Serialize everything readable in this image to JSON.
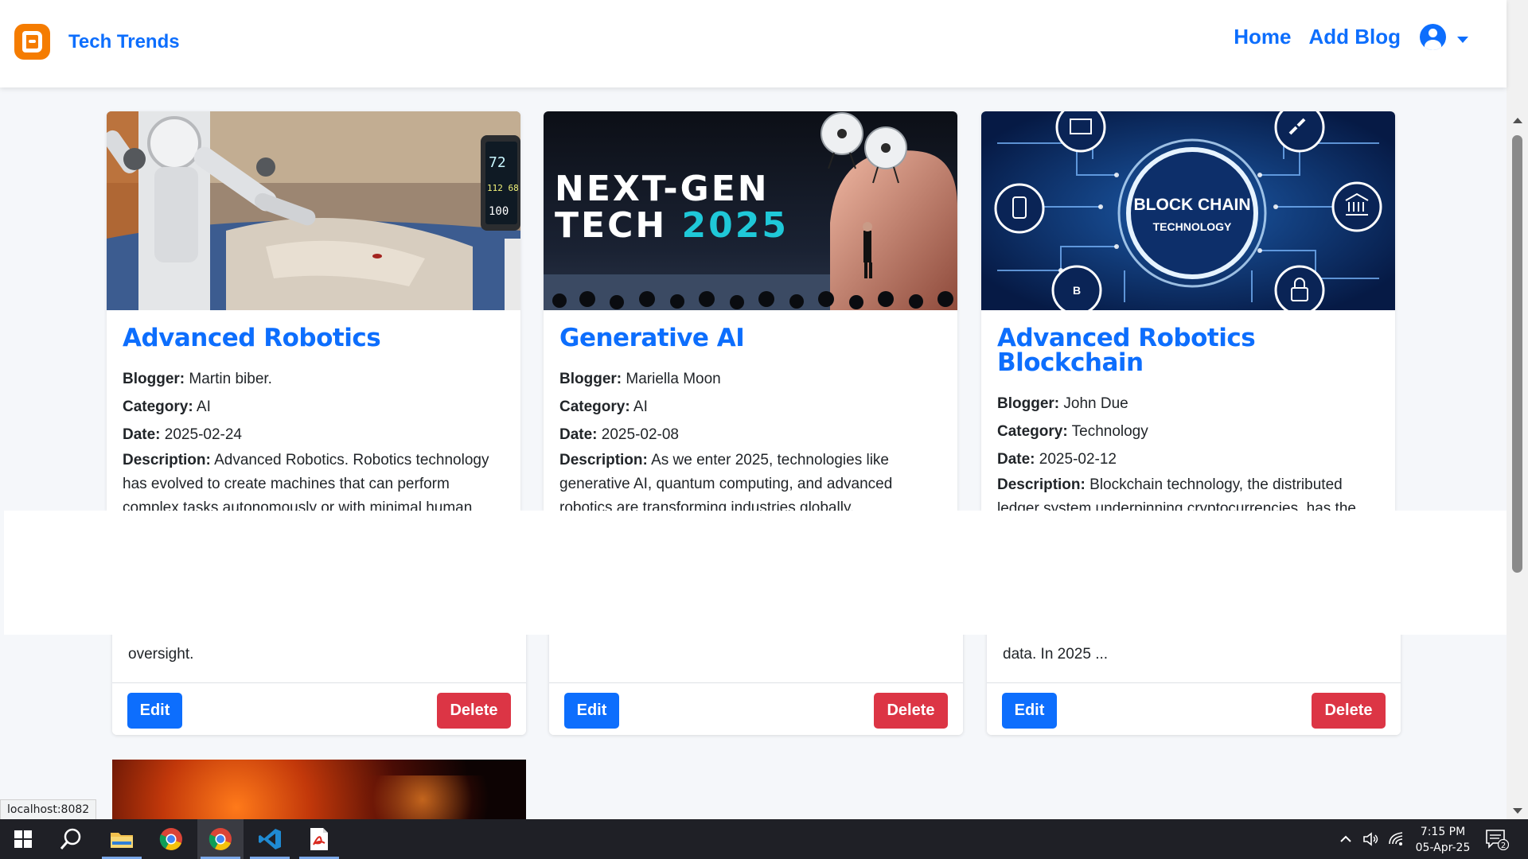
{
  "navbar": {
    "brand_title": "Tech Trends",
    "links": [
      "Home",
      "Add Blog"
    ],
    "accent_color": "#0d6efd"
  },
  "cards": [
    {
      "title": "Advanced Robotics",
      "blogger_label": "Blogger:",
      "blogger": "Martin biber.",
      "category_label": "Category:",
      "category": "AI",
      "date_label": "Date:",
      "date": "2025-02-24",
      "description_label": "Description:",
      "description": "Advanced Robotics. Robotics technology has evolved to create machines that can perform complex tasks autonomously or with minimal human",
      "description_tail": "oversight.",
      "edit_label": "Edit",
      "delete_label": "Delete"
    },
    {
      "title": "Generative AI",
      "blogger_label": "Blogger:",
      "blogger": "Mariella Moon",
      "category_label": "Category:",
      "category": "AI",
      "date_label": "Date:",
      "date": "2025-02-08",
      "description_label": "Description:",
      "description": "As we enter 2025, technologies like generative AI, quantum computing, and advanced robotics are transforming industries globally.",
      "description_tail": "",
      "image_text_line1": "NEXT-GEN",
      "image_text_line2a": "TECH ",
      "image_text_line2b": "2025",
      "edit_label": "Edit",
      "delete_label": "Delete"
    },
    {
      "title": "Advanced Robotics Blockchain",
      "blogger_label": "Blogger:",
      "blogger": "John Due",
      "category_label": "Category:",
      "category": "Technology",
      "date_label": "Date:",
      "date": "2025-02-12",
      "description_label": "Description:",
      "description": "Blockchain technology, the distributed ledger system underpinning cryptocurrencies, has the potential to revolutionise how we store and share",
      "description_tail": "data. In 2025 ...",
      "image_text_line1": "BLOCK CHAIN",
      "image_text_line2": "TECHNOLOGY",
      "image_badge": "B",
      "edit_label": "Edit",
      "delete_label": "Delete"
    }
  ],
  "robot_monitor": {
    "v1": "72",
    "v2": "112 68",
    "v3": "100"
  },
  "status_bar": {
    "url": "localhost:8082"
  },
  "taskbar": {
    "time": "7:15 PM",
    "date": "05-Apr-25",
    "notification_count": "2"
  },
  "colors": {
    "primary": "#0d6efd",
    "danger": "#dc3545",
    "brand_orange": "#f57c00",
    "taskbar": "#1f2026"
  }
}
